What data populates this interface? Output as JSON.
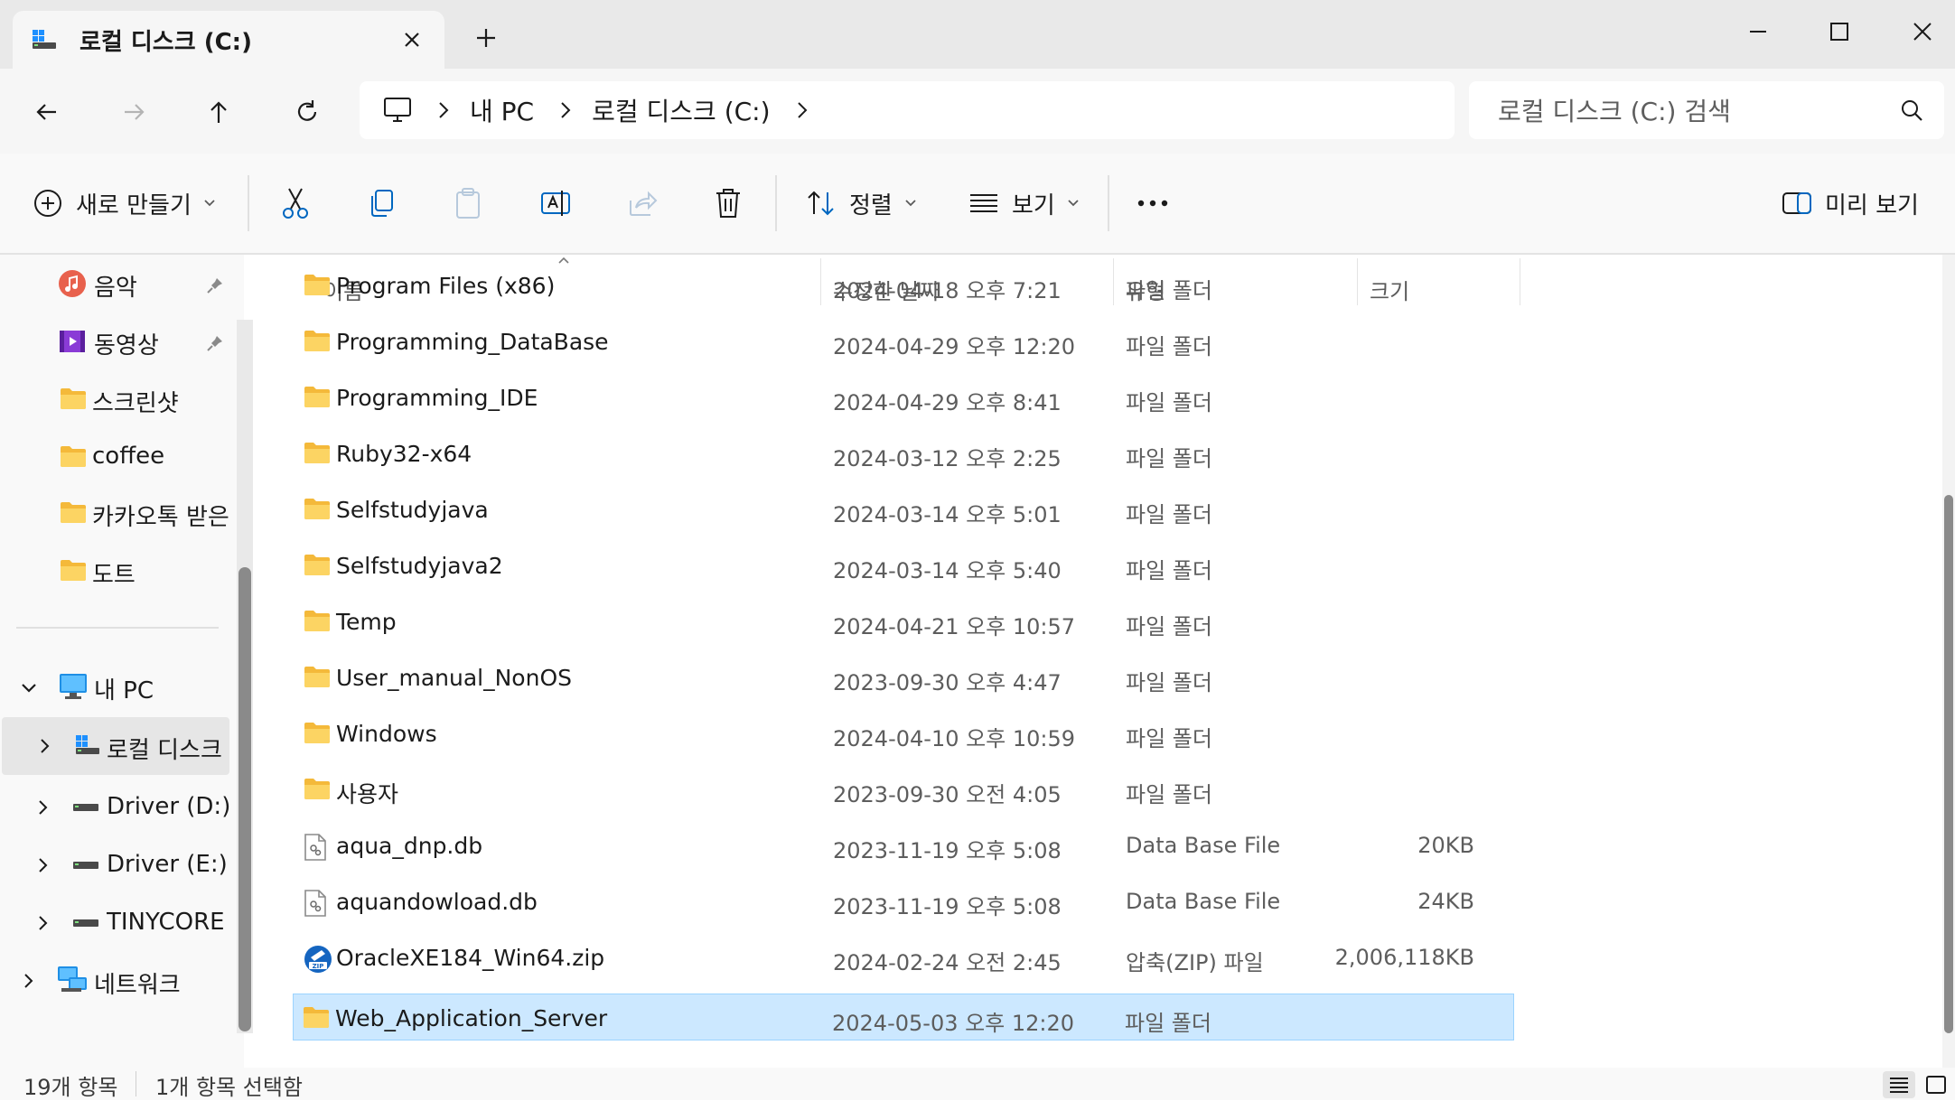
{
  "tab": {
    "title": "로컬 디스크 (C:)"
  },
  "address": {
    "crumbs": [
      "내 PC",
      "로컬 디스크 (C:)"
    ]
  },
  "search": {
    "placeholder": "로컬 디스크 (C:) 검색"
  },
  "toolbar": {
    "new_label": "새로 만들기",
    "sort_label": "정렬",
    "view_label": "보기",
    "preview_label": "미리 보기"
  },
  "nav": {
    "items": [
      {
        "label": "음악",
        "icon": "music-icon"
      },
      {
        "label": "동영상",
        "icon": "video-icon"
      },
      {
        "label": "스크린샷",
        "icon": "folder-icon"
      },
      {
        "label": "coffee",
        "icon": "folder-icon"
      },
      {
        "label": "카카오톡 받은",
        "icon": "folder-icon"
      },
      {
        "label": "도트",
        "icon": "folder-icon"
      },
      {
        "label": "내 PC",
        "icon": "computer-icon"
      },
      {
        "label": "로컬 디스크",
        "icon": "drive-icon"
      },
      {
        "label": "Driver (D:)",
        "icon": "drive-icon"
      },
      {
        "label": "Driver (E:)",
        "icon": "drive-icon"
      },
      {
        "label": "TINYCORE (L",
        "icon": "drive-icon"
      },
      {
        "label": "네트워크",
        "icon": "network-icon"
      }
    ]
  },
  "columns": {
    "name": "이름",
    "modified": "수정한 날짜",
    "type": "유형",
    "size": "크기"
  },
  "files": [
    {
      "name": "Program Files (x86)",
      "modified": "2024-04-18 오후 7:21",
      "type": "파일 폴더",
      "size": "",
      "icon": "folder-icon"
    },
    {
      "name": "Programming_DataBase",
      "modified": "2024-04-29 오후 12:20",
      "type": "파일 폴더",
      "size": "",
      "icon": "folder-icon"
    },
    {
      "name": "Programming_IDE",
      "modified": "2024-04-29 오후 8:41",
      "type": "파일 폴더",
      "size": "",
      "icon": "folder-icon"
    },
    {
      "name": "Ruby32-x64",
      "modified": "2024-03-12 오후 2:25",
      "type": "파일 폴더",
      "size": "",
      "icon": "folder-icon"
    },
    {
      "name": "Selfstudyjava",
      "modified": "2024-03-14 오후 5:01",
      "type": "파일 폴더",
      "size": "",
      "icon": "folder-icon"
    },
    {
      "name": "Selfstudyjava2",
      "modified": "2024-03-14 오후 5:40",
      "type": "파일 폴더",
      "size": "",
      "icon": "folder-icon"
    },
    {
      "name": "Temp",
      "modified": "2024-04-21 오후 10:57",
      "type": "파일 폴더",
      "size": "",
      "icon": "folder-icon"
    },
    {
      "name": "User_manual_NonOS",
      "modified": "2023-09-30 오후 4:47",
      "type": "파일 폴더",
      "size": "",
      "icon": "folder-icon"
    },
    {
      "name": "Windows",
      "modified": "2024-04-10 오후 10:59",
      "type": "파일 폴더",
      "size": "",
      "icon": "folder-icon"
    },
    {
      "name": "사용자",
      "modified": "2023-09-30 오전 4:05",
      "type": "파일 폴더",
      "size": "",
      "icon": "folder-icon"
    },
    {
      "name": "aqua_dnp.db",
      "modified": "2023-11-19 오후 5:08",
      "type": "Data Base File",
      "size": "20KB",
      "icon": "db-file-icon"
    },
    {
      "name": "aquandowload.db",
      "modified": "2023-11-19 오후 5:08",
      "type": "Data Base File",
      "size": "24KB",
      "icon": "db-file-icon"
    },
    {
      "name": "OracleXE184_Win64.zip",
      "modified": "2024-02-24 오전 2:45",
      "type": "압축(ZIP) 파일",
      "size": "2,006,118KB",
      "icon": "zip-file-icon"
    },
    {
      "name": "Web_Application_Server",
      "modified": "2024-05-03 오후 12:20",
      "type": "파일 폴더",
      "size": "",
      "icon": "folder-icon",
      "selected": true
    }
  ],
  "status": {
    "count": "19개 항목",
    "selection": "1개 항목 선택함"
  },
  "colors": {
    "accent": "#0067c0",
    "selection": "#cce8ff",
    "folder": "#f8c43e"
  }
}
